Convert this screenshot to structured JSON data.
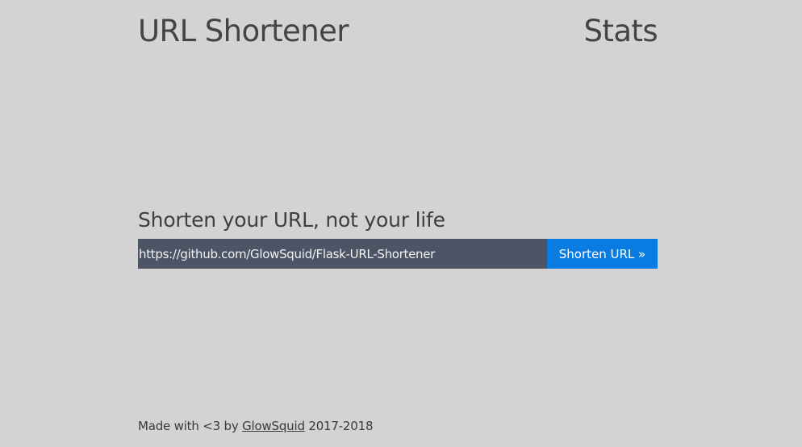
{
  "header": {
    "brand": "URL Shortener",
    "stats_link": "Stats"
  },
  "main": {
    "tagline": "Shorten your URL, not your life",
    "url_input_value": "https://github.com/GlowSquid/Flask-URL-Shortener",
    "submit_label": "Shorten URL »"
  },
  "footer": {
    "prefix": "Made with <3 by ",
    "author_link": "GlowSquid",
    "suffix": " 2017-2018"
  },
  "colors": {
    "background": "#d3d3d3",
    "input_background": "#4c5566",
    "button_background": "#0a7be0",
    "text": "#3c3c3c"
  }
}
